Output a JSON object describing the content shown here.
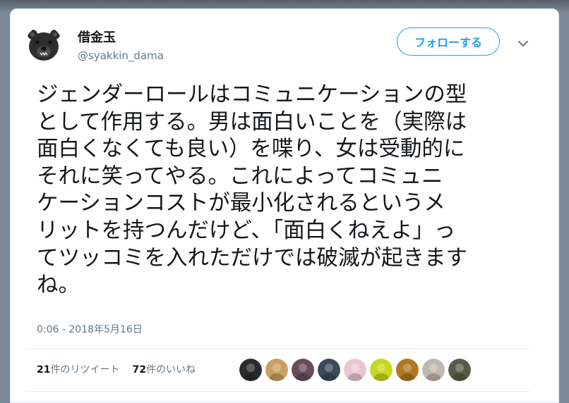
{
  "profile": {
    "display_name": "借金玉",
    "handle": "@syakkin_dama",
    "avatar_icon": "bear-face-icon"
  },
  "follow_button": {
    "label": "フォローする"
  },
  "menu": {
    "icon": "chevron-down-icon"
  },
  "tweet": {
    "lines": [
      "ジェンダーロールはコミュニケーションの型",
      "として作用する。男は面白いことを（実際は",
      "面白くなくても良い）を喋り、女は受動的に",
      "それに笑ってやる。これによってコミュニ",
      "ケーションコストが最小化されるというメ",
      "リットを持つんだけど、「面白くねえよ」っ",
      "てツッコミを入れただけでは破滅が起きます",
      "ね。"
    ],
    "timestamp": "0:06 - 2018年5月16日"
  },
  "stats": {
    "retweets_count": "21",
    "retweets_label": "件のリツイート",
    "likes_count": "72",
    "likes_label": "件のいいね"
  },
  "liker_avatars": [
    {
      "icon": "liker-avatar-1",
      "color": "#2b2b2b"
    },
    {
      "icon": "liker-avatar-2",
      "color": "#c8a060"
    },
    {
      "icon": "liker-avatar-3",
      "color": "#6a4a5a"
    },
    {
      "icon": "liker-avatar-4",
      "color": "#3a4a5a"
    },
    {
      "icon": "liker-avatar-5",
      "color": "#e8c8d0"
    },
    {
      "icon": "liker-avatar-6",
      "color": "#c8d820"
    },
    {
      "icon": "liker-avatar-7",
      "color": "#b07820"
    },
    {
      "icon": "liker-avatar-8",
      "color": "#c0b8b0"
    },
    {
      "icon": "liker-avatar-9",
      "color": "#5a5a48"
    }
  ],
  "colors": {
    "accent": "#1da1f2",
    "text": "#14171a",
    "muted": "#657786",
    "background": "#7b8896"
  }
}
